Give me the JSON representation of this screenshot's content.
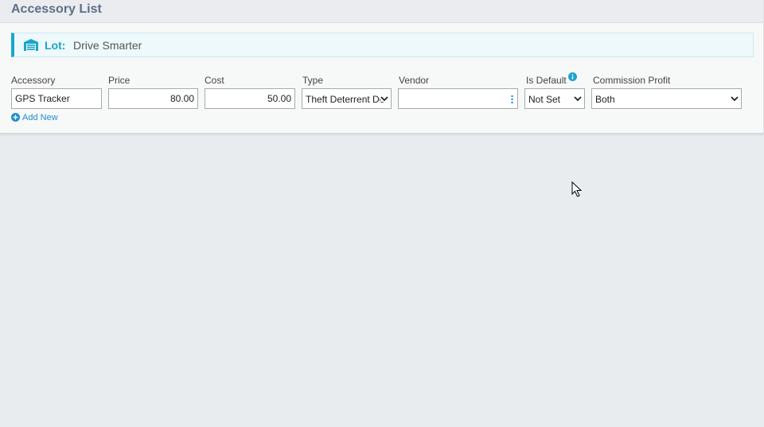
{
  "panel": {
    "title": "Accessory List"
  },
  "lot": {
    "label": "Lot:",
    "value": "Drive Smarter",
    "icon": "warehouse-icon"
  },
  "columns": {
    "accessory": "Accessory",
    "price": "Price",
    "cost": "Cost",
    "type": "Type",
    "vendor": "Vendor",
    "is_default": "Is Default",
    "commission_profit": "Commission Profit"
  },
  "row": {
    "accessory": "GPS Tracker",
    "price": "80.00",
    "cost": "50.00",
    "type": "Theft Deterrent De",
    "vendor": "",
    "is_default": "Not Set",
    "commission_profit": "Both"
  },
  "add_new": {
    "label": "Add New"
  },
  "colors": {
    "accent": "#1aa6c8",
    "title": "#5f6f86",
    "link": "#1f8fc9",
    "background": "#e9ecef"
  }
}
